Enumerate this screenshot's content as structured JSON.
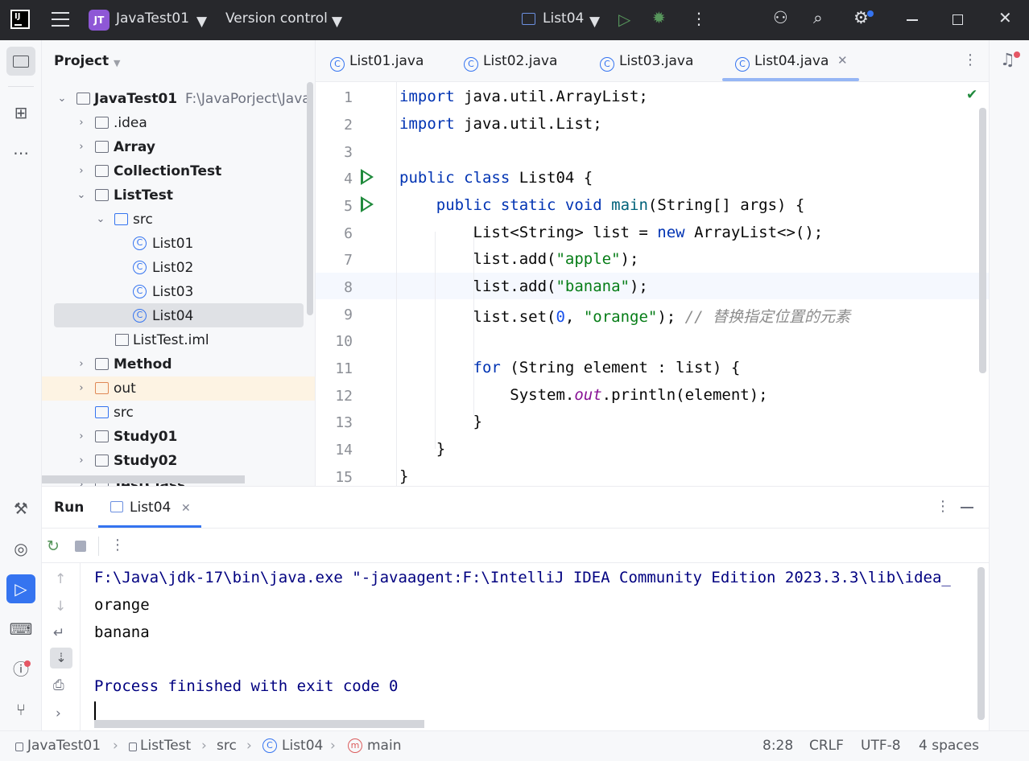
{
  "titlebar": {
    "project_badge": "JT",
    "project_name": "JavaTest01",
    "version_control": "Version control",
    "run_config": "List04"
  },
  "project_panel": {
    "title": "Project",
    "root_name": "JavaTest01",
    "root_path": "F:\\JavaPorject\\Java",
    "items": [
      {
        "label": ".idea"
      },
      {
        "label": "Array"
      },
      {
        "label": "CollectionTest"
      },
      {
        "label": "ListTest"
      },
      {
        "label": "src"
      },
      {
        "label": "List01"
      },
      {
        "label": "List02"
      },
      {
        "label": "List03"
      },
      {
        "label": "List04"
      },
      {
        "label": "ListTest.iml"
      },
      {
        "label": "Method"
      },
      {
        "label": "out"
      },
      {
        "label": "src"
      },
      {
        "label": "Study01"
      },
      {
        "label": "Study02"
      },
      {
        "label": "TestClass"
      }
    ]
  },
  "editor_tabs": [
    "List01.java",
    "List02.java",
    "List03.java",
    "List04.java"
  ],
  "editor": {
    "line_numbers": [
      "1",
      "2",
      "3",
      "4",
      "5",
      "6",
      "7",
      "8",
      "9",
      "10",
      "11",
      "12",
      "13",
      "14",
      "15"
    ],
    "comment_text": "// 替换指定位置的元素"
  },
  "run_panel": {
    "title": "Run",
    "tab": "List04",
    "output": [
      "F:\\Java\\jdk-17\\bin\\java.exe \"-javaagent:F:\\IntelliJ IDEA Community Edition 2023.3.3\\lib\\idea_",
      "orange",
      "banana",
      "",
      "Process finished with exit code 0"
    ]
  },
  "status_bar": {
    "crumbs": [
      "JavaTest01",
      "ListTest",
      "src",
      "List04",
      "main"
    ],
    "position": "8:28",
    "line_sep": "CRLF",
    "encoding": "UTF-8",
    "indent": "4 spaces"
  },
  "colors": {
    "accent": "#3574f0",
    "run_green": "#208a3c",
    "titlebar": "#27282c"
  }
}
